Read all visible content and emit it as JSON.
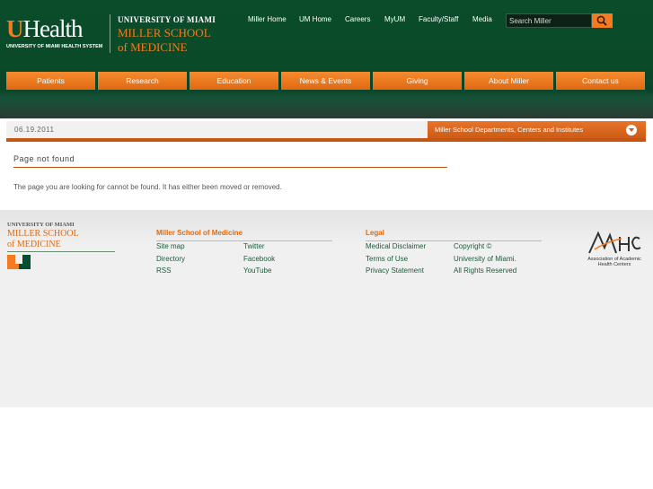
{
  "header": {
    "uhealth_logo_text": "UHealth",
    "uhealth_logo_sub": "UNIVERSITY OF MIAMI HEALTH SYSTEM",
    "univ_line": "UNIVERSITY OF MIAMI",
    "school_line1": "MILLER SCHOOL",
    "school_line2": "of MEDICINE",
    "topnav": [
      "Miller Home",
      "UM Home",
      "Careers",
      "MyUM",
      "Faculty/Staff",
      "Media"
    ],
    "search_placeholder": "Search Miller",
    "search_icon": "magnifier-icon",
    "accent_color": "#f47b20",
    "header_color": "#0a4d2b"
  },
  "mainnav": [
    "Patients",
    "Research",
    "Education",
    "News & Events",
    "Giving",
    "About Miller",
    "Contact us"
  ],
  "content": {
    "date": "06.19.2011",
    "departments_dropdown": "Miller School Departments, Centers and Institutes",
    "page_title": "Page not found",
    "message": "The page you are looking for cannot be found. It has either been moved or removed."
  },
  "footer": {
    "logo_univ": "UNIVERSITY OF MIAMI",
    "logo_school1": "MILLER SCHOOL",
    "logo_school2": "of MEDICINE",
    "col1_head": "Miller School of Medicine",
    "col1_left": [
      "Site map",
      "Directory",
      "RSS"
    ],
    "col1_right": [
      "Twitter",
      "Facebook",
      "YouTube"
    ],
    "col2_head": "Legal",
    "col2_left": [
      "Medical Disclaimer",
      "Terms of Use",
      "Privacy Statement"
    ],
    "col2_right": [
      "Copyright ©",
      "University of Miami.",
      "All Rights Reserved"
    ],
    "aahc_mark": "AAHC",
    "aahc_line1": "Association of Academic",
    "aahc_line2": "Health Centers"
  }
}
